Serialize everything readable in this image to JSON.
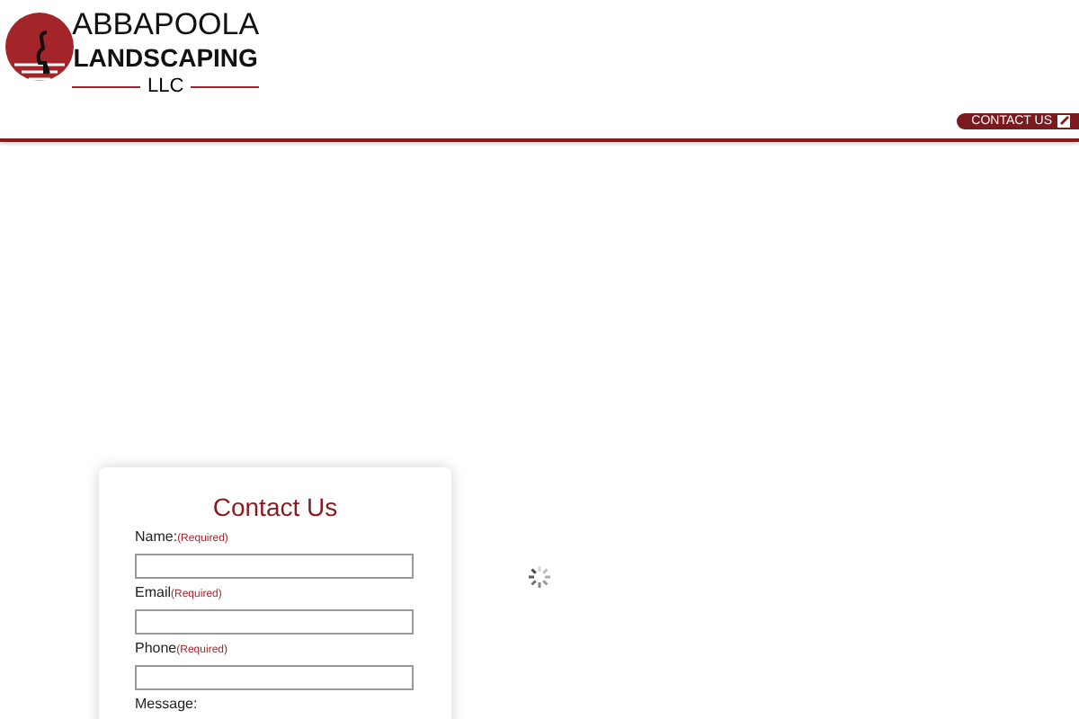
{
  "logo": {
    "line_1": "ABBAPOOLA",
    "line_2": "LANDSCAPING",
    "line_3": "LLC"
  },
  "header": {
    "contact_button": "CONTACT US"
  },
  "contact_form": {
    "title": "Contact Us",
    "fields": [
      {
        "label": "Name:",
        "required_text": "(Required)",
        "kind": "input"
      },
      {
        "label": "Email",
        "required_text": "(Required)",
        "kind": "input"
      },
      {
        "label": "Phone",
        "required_text": "(Required)",
        "kind": "input"
      },
      {
        "label": "Message:",
        "kind": "label"
      }
    ]
  }
}
